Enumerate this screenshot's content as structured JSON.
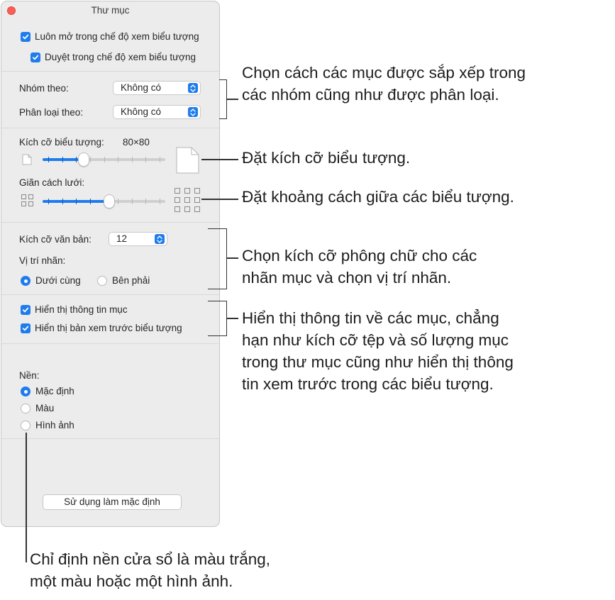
{
  "window": {
    "title": "Thư mục",
    "always_open_icon_view": "Luôn mở trong chế độ xem biểu tượng",
    "browse_icon_view": "Duyệt trong chế độ xem biểu tượng",
    "group_by_label": "Nhóm theo:",
    "group_by_value": "Không có",
    "sort_by_label": "Phân loại theo:",
    "sort_by_value": "Không có",
    "icon_size_label": "Kích cỡ biểu tượng:",
    "icon_size_value": "80×80",
    "icon_size_fraction": 0.32,
    "grid_spacing_label": "Giãn cách lưới:",
    "grid_spacing_fraction": 0.55,
    "text_size_label": "Kích cỡ văn bản:",
    "text_size_value": "12",
    "label_position_label": "Vị trí nhãn:",
    "label_bottom": "Dưới cùng",
    "label_right": "Bên phải",
    "show_item_info": "Hiển thị thông tin mục",
    "show_icon_preview": "Hiển thị bản xem trước biểu tượng",
    "background_label": "Nền:",
    "bg_default": "Mặc định",
    "bg_color": "Màu",
    "bg_picture": "Hình ảnh",
    "use_as_defaults": "Sử dụng làm mặc định"
  },
  "callouts": {
    "grouping_line1": "Chọn cách các mục được sắp xếp trong",
    "grouping_line2": "các nhóm cũng như được phân loại.",
    "icon_size": "Đặt kích cỡ biểu tượng.",
    "grid_spacing": "Đặt khoảng cách giữa các biểu tượng.",
    "text_line1": "Chọn kích cỡ phông chữ cho các",
    "text_line2": "nhãn mục và chọn vị trí nhãn.",
    "info_line1": "Hiển thị thông tin về các mục, chẳng",
    "info_line2": "hạn như kích cỡ tệp và số lượng mục",
    "info_line3": "trong thư mục cũng như hiển thị thông",
    "info_line4": "tin xem trước trong các biểu tượng.",
    "bg_line1": "Chỉ định nền cửa sổ là màu trắng,",
    "bg_line2": "một màu hoặc một hình ảnh."
  },
  "colors": {
    "accent": "#1f7ced",
    "window_bg": "#ececec",
    "close": "#ff5f57"
  }
}
